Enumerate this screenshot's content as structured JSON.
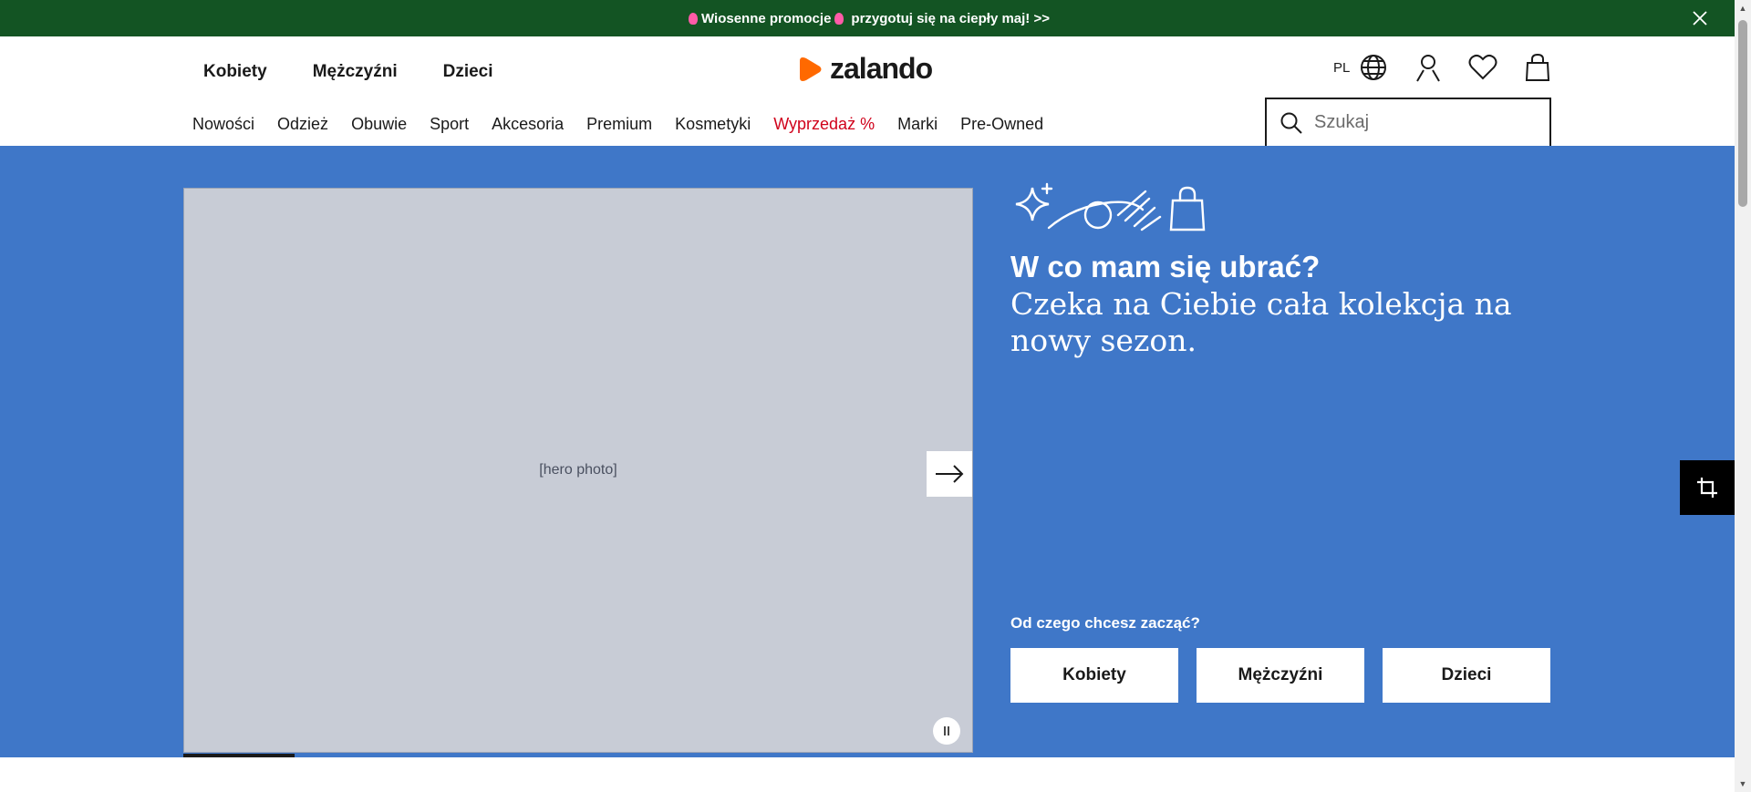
{
  "promo": {
    "text_before": "Wiosenne promocje",
    "text_after": "przygotuj się na ciepły maj! >>"
  },
  "header": {
    "gender_nav": [
      "Kobiety",
      "Mężczyźni",
      "Dzieci"
    ],
    "logo": "zalando",
    "language": "PL",
    "categories": [
      "Nowości",
      "Odzież",
      "Obuwie",
      "Sport",
      "Akcesoria",
      "Premium",
      "Kosmetyki",
      "Wyprzedaż %",
      "Marki",
      "Pre-Owned"
    ],
    "search_placeholder": "Szukaj"
  },
  "hero": {
    "title": "W co mam się ubrać?",
    "subtitle": "Czeka na Ciebie cała kolekcja na nowy sezon.",
    "start_label": "Od czego chcesz zacząć?",
    "cta_buttons": [
      "Kobiety",
      "Mężczyźni",
      "Dzieci"
    ],
    "image_label": "[hero photo]"
  },
  "colors": {
    "promo_bg": "#135423",
    "hero_bg": "#3f77c8",
    "brand_orange": "#ff6900",
    "sale_red": "#d0021b"
  },
  "icons": [
    "close-icon",
    "zalando-logo-icon",
    "globe-icon",
    "user-icon",
    "heart-icon",
    "bag-icon",
    "search-icon",
    "arrow-right-icon",
    "pause-icon",
    "crop-icon"
  ]
}
